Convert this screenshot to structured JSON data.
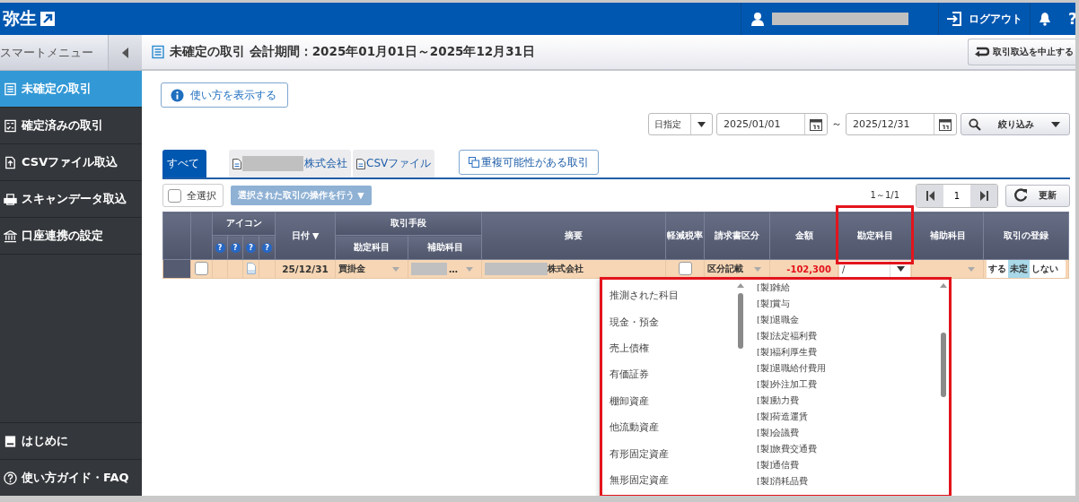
{
  "header": {
    "logo": "弥生",
    "user_redacted": true,
    "logout": "ログアウト",
    "help": "?"
  },
  "sidebar": {
    "title": "スマートメニュー",
    "items": [
      {
        "label": "未確定の取引",
        "selected": true
      },
      {
        "label": "確定済みの取引",
        "selected": false
      },
      {
        "label": "CSVファイル取込",
        "selected": false
      },
      {
        "label": "スキャンデータ取込",
        "selected": false
      },
      {
        "label": "口座連携の設定",
        "selected": false
      }
    ],
    "footer_items": [
      {
        "label": "はじめに"
      },
      {
        "label": "使い方ガイド・FAQ"
      }
    ]
  },
  "page": {
    "title": "未確定の取引 会計期間：2025年01月01日～2025年12月31日",
    "stop_button": "取引取込を中止する",
    "help_button": "使い方を表示する"
  },
  "filter": {
    "mode": "日指定",
    "from": "2025/01/01",
    "separator": "～",
    "to": "2025/12/31",
    "button": "絞り込み"
  },
  "tabs": [
    {
      "label": "すべて",
      "redacted": false,
      "selected": true
    },
    {
      "label": "株式会社",
      "redacted": true,
      "selected": false
    },
    {
      "label": "CSVファイル",
      "redacted": false,
      "selected": false
    }
  ],
  "duplicate_button": "重複可能性がある取引",
  "select_all": {
    "label": "全選択",
    "checked": false
  },
  "bulk_action": {
    "label": "選択された取引の操作を行う ▼",
    "disabled": true
  },
  "pager": {
    "range": "1～1/1",
    "page": "1",
    "refresh": "更新"
  },
  "table": {
    "icon_group": "アイコン",
    "icon_help": [
      "?",
      "?",
      "?",
      "?"
    ],
    "date": "日付 ▼",
    "method": "取引手段",
    "method_account": "勘定科目",
    "method_sub": "補助科目",
    "summary": "摘要",
    "reduced_tax": "軽減税率",
    "invoice": "請求書区分",
    "amount": "金額",
    "account": "勘定科目",
    "account_highlighted": true,
    "sub_account": "補助科目",
    "register": "取引の登録",
    "rows": [
      {
        "checked": false,
        "has_document": true,
        "date": "25/12/31",
        "method_account": "買掛金",
        "method_sub": "…",
        "method_sub_redacted": true,
        "summary": "株式会社",
        "summary_redacted": true,
        "reduced_tax": false,
        "invoice": "区分記載",
        "amount": "-102,300",
        "negative": true,
        "account": "/",
        "register": [
          {
            "label": "する",
            "selected": false
          },
          {
            "label": "未定",
            "selected": true
          },
          {
            "label": "しない",
            "selected": false
          }
        ]
      }
    ]
  },
  "dropdown": {
    "highlighted": true,
    "categories": [
      "推測された科目",
      "現金・預金",
      "売上債権",
      "有価証券",
      "棚卸資産",
      "他流動資産",
      "有形固定資産",
      "無形固定資産"
    ],
    "accounts": [
      "[製]雑給",
      "[製]賞与",
      "[製]退職金",
      "[製]法定福利費",
      "[製]福利厚生費",
      "[製]退職給付費用",
      "[製]外注加工費",
      "[製]動力費",
      "[製]荷造運賃",
      "[製]会議費",
      "[製]旅費交通費",
      "[製]通信費",
      "[製]消耗品費"
    ]
  }
}
